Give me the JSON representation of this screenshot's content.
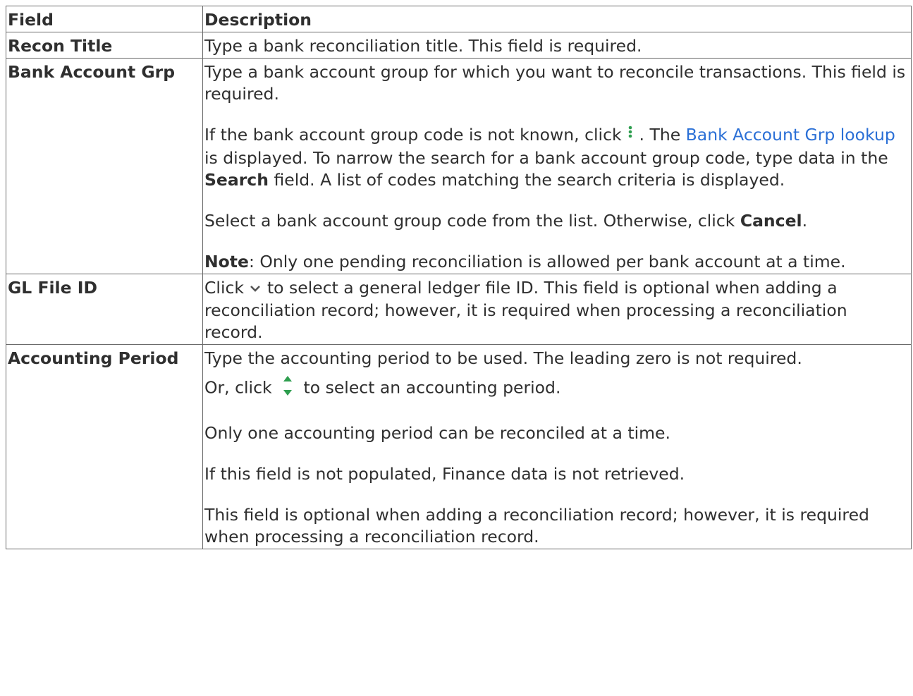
{
  "table": {
    "headers": {
      "field": "Field",
      "description": "Description"
    },
    "recon_title": {
      "field": "Recon Title",
      "desc": "Type a bank reconciliation title. This field is required."
    },
    "bank_account_grp": {
      "field": "Bank Account Grp",
      "p1": "Type a bank account group for which you want to reconcile transactions. This field is required.",
      "p2_a": "If the bank account group code is not known, click ",
      "p2_icon": "vertical-ellipsis-icon",
      "p2_b": " . The ",
      "p2_link": "Bank Account Grp lookup",
      "p2_c": " is displayed. To narrow the search for a bank account group code, type data in the ",
      "p2_bold": "Search",
      "p2_d": " field. A list of codes matching the search criteria is displayed.",
      "p3_a": "Select a bank account group code from the list. Otherwise, click ",
      "p3_bold": "Cancel",
      "p3_b": ".",
      "p4_bold": "Note",
      "p4_a": ": Only one pending reconciliation is allowed per bank account at a time."
    },
    "gl_file_id": {
      "field": "GL File ID",
      "a": "Click ",
      "icon": "chevron-down-icon",
      "b": " to select a general ledger file ID. This field is optional when adding a reconciliation record; however, it is required when processing a reconciliation record."
    },
    "accounting_period": {
      "field": "Accounting Period",
      "p1": "Type the accounting period to be used. The leading zero is not required.",
      "p2_a": "Or, click ",
      "p2_icon": "spinner-arrows-icon",
      "p2_b": " to select an accounting period.",
      "p3": "Only one accounting period can be reconciled at a time.",
      "p4": "If this field is not populated, Finance data is not retrieved.",
      "p5": "This field is optional when adding a reconciliation record; however, it is required when processing a reconciliation record."
    }
  },
  "colors": {
    "link": "#2a6fd6",
    "icon_green": "#2e9e4f",
    "icon_gray": "#555555",
    "border": "#6b6b6b"
  }
}
